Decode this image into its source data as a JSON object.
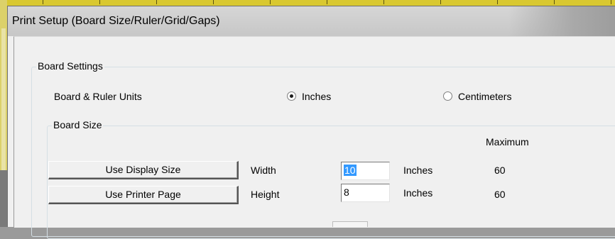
{
  "window": {
    "title": "Print Setup (Board Size/Ruler/Grid/Gaps)"
  },
  "board_settings": {
    "legend": "Board Settings",
    "units_label": "Board & Ruler Units",
    "units": {
      "options": [
        {
          "label": "Inches",
          "selected": true
        },
        {
          "label": "Centimeters",
          "selected": false
        }
      ]
    }
  },
  "board_size": {
    "legend": "Board Size",
    "maximum_header": "Maximum",
    "use_display_size_label": "Use Display Size",
    "use_printer_page_label": "Use Printer Page",
    "rows": [
      {
        "label": "Width",
        "value": "10",
        "unit": "Inches",
        "max": "60"
      },
      {
        "label": "Height",
        "value": "8",
        "unit": "Inches",
        "max": "60"
      }
    ]
  },
  "colors": {
    "background_ruler": "#d9c830",
    "dialog_face": "#f0f0f0",
    "selection": "#3399ff"
  }
}
